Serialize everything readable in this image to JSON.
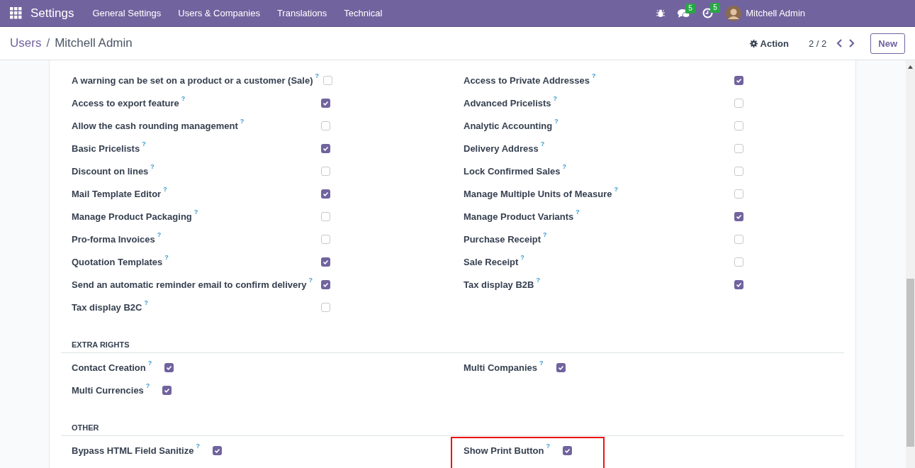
{
  "navbar": {
    "app_title": "Settings",
    "menus": [
      "General Settings",
      "Users & Companies",
      "Translations",
      "Technical"
    ],
    "messages_count": "5",
    "activities_count": "5",
    "user_name": "Mitchell Admin"
  },
  "control_panel": {
    "breadcrumb_parent": "Users",
    "breadcrumb_separator": "/",
    "breadcrumb_current": "Mitchell Admin",
    "action": "Action",
    "pager": "2 / 2",
    "new_button": "New"
  },
  "sections": [
    {
      "kind": "aligned",
      "columns": [
        [
          {
            "label": "A warning can be set on a product or a customer (Sale)",
            "help": "?",
            "checked": false
          },
          {
            "label": "Access to export feature",
            "help": "?",
            "checked": true
          },
          {
            "label": "Allow the cash rounding management",
            "help": "?",
            "checked": false
          },
          {
            "label": "Basic Pricelists",
            "help": "?",
            "checked": true
          },
          {
            "label": "Discount on lines",
            "help": "?",
            "checked": false
          },
          {
            "label": "Mail Template Editor",
            "help": "?",
            "checked": true
          },
          {
            "label": "Manage Product Packaging",
            "help": "?",
            "checked": false
          },
          {
            "label": "Pro-forma Invoices",
            "help": "?",
            "checked": false
          },
          {
            "label": "Quotation Templates",
            "help": "?",
            "checked": true
          },
          {
            "label": "Send an automatic reminder email to confirm delivery",
            "help": "?",
            "checked": true
          },
          {
            "label": "Tax display B2C",
            "help": "?",
            "checked": false
          }
        ],
        [
          {
            "label": "Access to Private Addresses",
            "help": "?",
            "checked": true
          },
          {
            "label": "Advanced Pricelists",
            "help": "?",
            "checked": false
          },
          {
            "label": "Analytic Accounting",
            "help": "?",
            "checked": false
          },
          {
            "label": "Delivery Address",
            "help": "?",
            "checked": false
          },
          {
            "label": "Lock Confirmed Sales",
            "help": "?",
            "checked": false
          },
          {
            "label": "Manage Multiple Units of Measure",
            "help": "?",
            "checked": false
          },
          {
            "label": "Manage Product Variants",
            "help": "?",
            "checked": true
          },
          {
            "label": "Purchase Receipt",
            "help": "?",
            "checked": false
          },
          {
            "label": "Sale Receipt",
            "help": "?",
            "checked": false
          },
          {
            "label": "Tax display B2B",
            "help": "?",
            "checked": true
          }
        ]
      ]
    },
    {
      "kind": "inline",
      "title": "EXTRA RIGHTS",
      "columns": [
        [
          {
            "label": "Contact Creation",
            "help": "?",
            "checked": true
          },
          {
            "label": "Multi Currencies",
            "help": "?",
            "checked": true
          }
        ],
        [
          {
            "label": "Multi Companies",
            "help": "?",
            "checked": true
          }
        ]
      ]
    },
    {
      "kind": "inline",
      "title": "OTHER",
      "columns": [
        [
          {
            "label": "Bypass HTML Field Sanitize",
            "help": "?",
            "checked": true
          }
        ],
        [
          {
            "label": "Show Print Button",
            "help": "?",
            "checked": true,
            "highlighted": true
          }
        ]
      ]
    }
  ]
}
